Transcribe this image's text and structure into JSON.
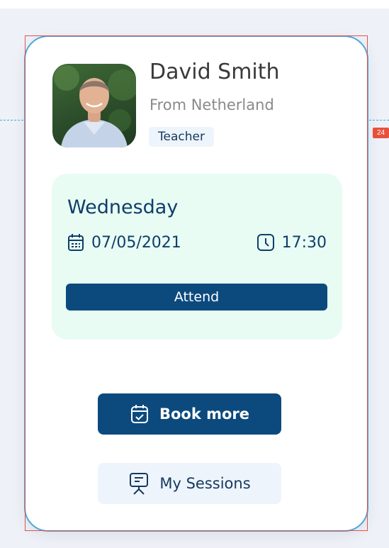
{
  "profile": {
    "name": "David Smith",
    "origin": "From Netherland",
    "role": "Teacher"
  },
  "session": {
    "day": "Wednesday",
    "date": "07/05/2021",
    "time": "17:30",
    "attend_label": "Attend"
  },
  "actions": {
    "book_more_label": "Book more",
    "my_sessions_label": "My Sessions"
  },
  "inspector": {
    "badge": "24"
  },
  "icons": {
    "date": "calendar-icon",
    "time": "clock-icon",
    "book": "calendar-check-icon",
    "sessions": "presentation-board-icon"
  },
  "colors": {
    "primary": "#0c4a7e",
    "session_bg": "#e8fcf3",
    "badge_bg": "#eef4fb",
    "card_border": "#4fa6da"
  }
}
